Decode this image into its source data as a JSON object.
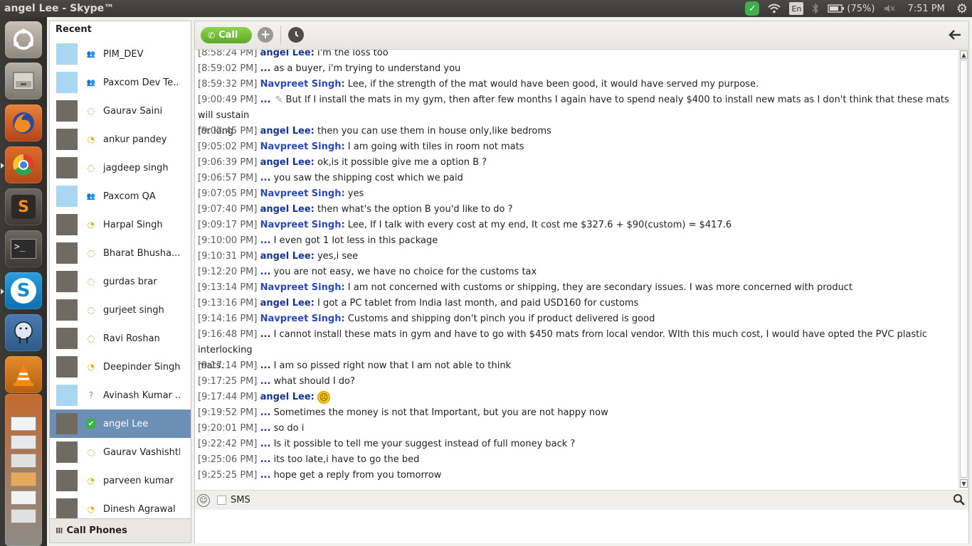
{
  "top_panel": {
    "title": "angel Lee - Skype™",
    "battery": "(75%)",
    "clock": "7:51 PM",
    "lang": "En",
    "icons": [
      "skype-status-icon",
      "wifi-icon",
      "keyboard-lang-icon",
      "bluetooth-icon",
      "battery-icon",
      "volume-muted-icon",
      "gear-icon"
    ]
  },
  "launcher": {
    "apps": [
      "ubuntu-dash",
      "files",
      "firefox",
      "chrome",
      "sublime-text",
      "terminal",
      "skype",
      "postgres",
      "vlc",
      "libreoffice",
      "spreadsheet",
      "document",
      "presentation",
      "calc",
      "amazon",
      "writer",
      "trash"
    ]
  },
  "sidebar": {
    "header": "Recent",
    "call_phones": "Call Phones",
    "contacts": [
      {
        "name": "PIM_DEV",
        "status": "group"
      },
      {
        "name": "Paxcom Dev Te...",
        "status": "group"
      },
      {
        "name": "Gaurav Saini",
        "status": "offline"
      },
      {
        "name": "ankur pandey",
        "status": "away"
      },
      {
        "name": "jagdeep singh",
        "status": "offline"
      },
      {
        "name": "Paxcom QA",
        "status": "group"
      },
      {
        "name": "Harpal Singh",
        "status": "away"
      },
      {
        "name": "Bharat Bhusha...",
        "status": "offline"
      },
      {
        "name": "gurdas brar",
        "status": "offline"
      },
      {
        "name": "gurjeet singh",
        "status": "offline"
      },
      {
        "name": "Ravi Roshan",
        "status": "offline"
      },
      {
        "name": "Deepinder Singh",
        "status": "away"
      },
      {
        "name": "Avinash Kumar ...",
        "status": "unknown"
      },
      {
        "name": "angel Lee",
        "status": "online",
        "selected": true
      },
      {
        "name": "Gaurav Vashishth",
        "status": "offline"
      },
      {
        "name": "parveen  kumar",
        "status": "away"
      },
      {
        "name": "Dinesh Agrawal",
        "status": "away"
      }
    ]
  },
  "chat": {
    "call_label": "Call",
    "sms_label": "SMS",
    "messages": [
      {
        "ts": "[8:58:24 PM]",
        "sender": "angel Lee:",
        "text": "i'm the loss too"
      },
      {
        "ts": "[8:59:02 PM]",
        "sender": "...",
        "text": "as a buyer, i'm trying to understand you"
      },
      {
        "ts": "[8:59:32 PM]",
        "sender": "Navpreet Singh:",
        "text": "Lee, if the strength of the mat would have been good, it would have served my purpose."
      },
      {
        "ts": "[9:00:49 PM]",
        "sender": "...",
        "text": "But If I install the mats in my gym, then after few months I again have to spend nealy $400 to install new mats as I don't think that these mats will sustain",
        "cont": "for long",
        "edited": true
      },
      {
        "ts": "[9:02:45 PM]",
        "sender": "angel Lee:",
        "text": "then you can use them in house only,like bedroms"
      },
      {
        "ts": "[9:05:02 PM]",
        "sender": "Navpreet Singh:",
        "text": "I am going with tiles in room not mats"
      },
      {
        "ts": "[9:06:39 PM]",
        "sender": "angel Lee:",
        "text": "ok,is it possible give me a option B ?"
      },
      {
        "ts": "[9:06:57 PM]",
        "sender": "...",
        "text": "you saw the shipping cost which we paid"
      },
      {
        "ts": "[9:07:05 PM]",
        "sender": "Navpreet Singh:",
        "text": "yes"
      },
      {
        "ts": "[9:07:40 PM]",
        "sender": "angel Lee:",
        "text": "then what's the option B you'd like to do ?"
      },
      {
        "ts": "[9:09:17 PM]",
        "sender": "Navpreet Singh:",
        "text": "Lee, If I talk with every cost at my end, It cost me $327.6 + $90(custom) = $417.6"
      },
      {
        "ts": "[9:10:00 PM]",
        "sender": "...",
        "text": "I even got 1 lot less in this package"
      },
      {
        "ts": "[9:10:31 PM]",
        "sender": "angel Lee:",
        "text": "yes,i see"
      },
      {
        "ts": "[9:12:20 PM]",
        "sender": "...",
        "text": "you are not easy, we have no choice for the customs tax"
      },
      {
        "ts": "[9:13:14 PM]",
        "sender": "Navpreet Singh:",
        "text": "I am not concerned with customs or shipping, they are secondary issues. I was more concerned with product"
      },
      {
        "ts": "[9:13:16 PM]",
        "sender": "angel Lee:",
        "text": "I got a PC tablet from India last month, and paid USD160 for customs"
      },
      {
        "ts": "[9:14:16 PM]",
        "sender": "Navpreet Singh:",
        "text": "Customs and shipping don't pinch you if product delivered is good"
      },
      {
        "ts": "[9:16:48 PM]",
        "sender": "...",
        "text": "I cannot install these mats in gym and have to go with $450 mats from local vendor. WIth this much cost, I would have opted the PVC plastic interlocking",
        "cont": "mats."
      },
      {
        "ts": "[9:17:14 PM]",
        "sender": "...",
        "text": "I am so pissed right now that I am not able to think"
      },
      {
        "ts": "[9:17:25 PM]",
        "sender": "...",
        "text": "what should I do?"
      },
      {
        "ts": "[9:17:44 PM]",
        "sender": "angel Lee:",
        "text": "",
        "emoticon": "sad-emoticon"
      },
      {
        "ts": "[9:19:52 PM]",
        "sender": "...",
        "text": "Sometimes the money is not that Important, but you are not happy now"
      },
      {
        "ts": "[9:20:01 PM]",
        "sender": "...",
        "text": "so do i"
      },
      {
        "ts": "[9:22:42 PM]",
        "sender": "...",
        "text": "Is it possible to tell me your suggest instead of full money back ?"
      },
      {
        "ts": "[9:25:06 PM]",
        "sender": "...",
        "text": "its too late,i have to go the bed"
      },
      {
        "ts": "[9:25:25 PM]",
        "sender": "...",
        "text": "hope get a reply from you tomorrow"
      }
    ]
  }
}
